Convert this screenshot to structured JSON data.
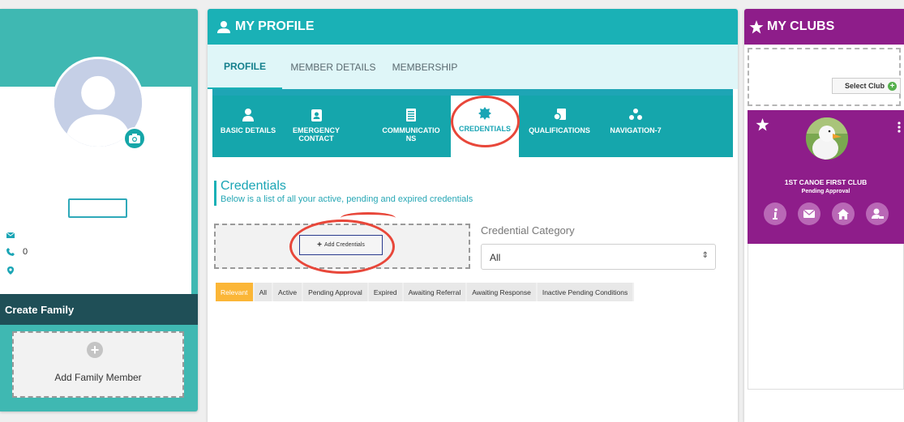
{
  "left": {
    "phone_value": "0",
    "create_family_label": "Create Family",
    "add_family_label": "Add Family Member",
    "add_family_plus": "+"
  },
  "profile": {
    "header_title": "MY PROFILE",
    "tabs": [
      "PROFILE",
      "MEMBER DETAILS",
      "MEMBERSHIP"
    ],
    "active_tab": "PROFILE",
    "icon_tabs": [
      {
        "label_line1": "BASIC DETAILS",
        "label_line2": "",
        "icon": "person-icon"
      },
      {
        "label_line1": "EMERGENCY",
        "label_line2": "CONTACT",
        "icon": "contact-card-icon"
      },
      {
        "label_line1": "COMMUNICATIO",
        "label_line2": "NS",
        "icon": "document-list-icon"
      },
      {
        "label_line1": "CREDENTIALS",
        "label_line2": "",
        "icon": "badge-icon"
      },
      {
        "label_line1": "QUALIFICATIONS",
        "label_line2": "",
        "icon": "certificate-icon"
      },
      {
        "label_line1": "NAVIGATION-7",
        "label_line2": "",
        "icon": "group-icon"
      }
    ],
    "active_icon_tab": "CREDENTIALS",
    "credentials": {
      "title": "Credentials",
      "subtitle": "Below is a list of all your active, pending and expired credentials",
      "add_button": "Add Credentials",
      "add_button_icon": "+",
      "category_label": "Credential Category",
      "category_value": "All"
    },
    "filters": [
      "Relevant",
      "All",
      "Active",
      "Pending Approval",
      "Expired",
      "Awaiting Referral",
      "Awaiting Response",
      "Inactive Pending Conditions"
    ],
    "active_filter": "Relevant"
  },
  "clubs": {
    "header_title": "MY CLUBS",
    "select_club_label": "Select Club",
    "select_club_plus": "+",
    "club_name": "1ST CANOE FIRST CLUB",
    "club_status": "Pending Approval",
    "club_action_icons": [
      "info-icon",
      "mail-icon",
      "home-icon",
      "user-edit-icon"
    ]
  },
  "colors": {
    "teal": "#1ab1b6",
    "dark_teal": "#1f4f57",
    "purple": "#8e1d8a",
    "annotation_red": "#e8473a",
    "filter_active": "#fbb637"
  }
}
